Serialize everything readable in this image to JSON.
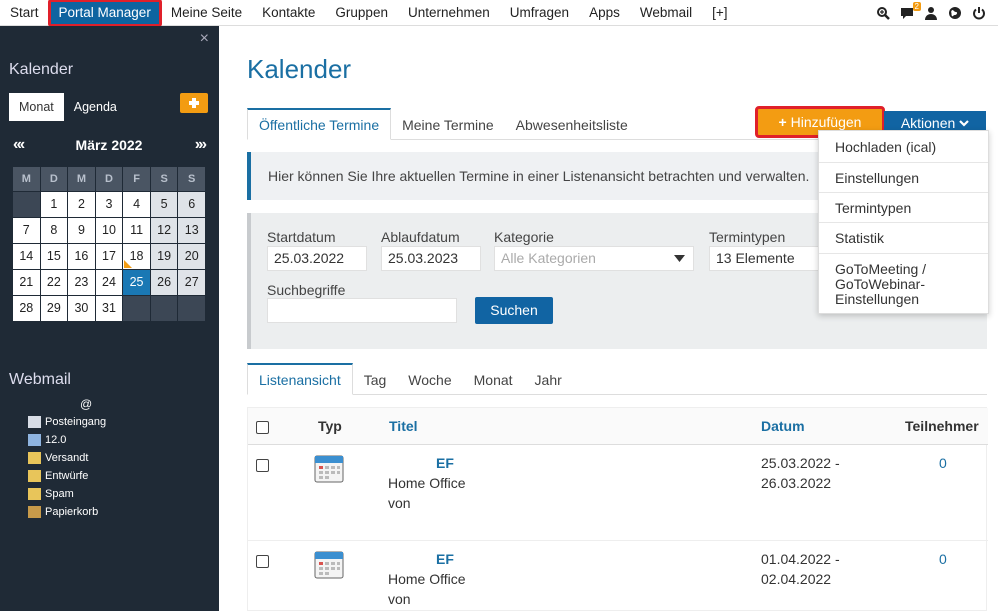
{
  "topnav": {
    "items": [
      "Start",
      "Portal Manager",
      "Meine Seite",
      "Kontakte",
      "Gruppen",
      "Unternehmen",
      "Umfragen",
      "Apps",
      "Webmail",
      "[+]"
    ],
    "active_index": 1,
    "notification_count": "2",
    "icons": [
      "search-icon",
      "chat-icon",
      "user-icon",
      "globe-icon",
      "power-icon"
    ]
  },
  "sidebar": {
    "close": "×",
    "calendar_title": "Kalender",
    "tabs": [
      "Monat",
      "Agenda"
    ],
    "add": "+",
    "month_label": "März 2022",
    "nav_prev": "«‹",
    "nav_next": "›»",
    "weekday_headers": [
      "M",
      "D",
      "M",
      "D",
      "F",
      "S",
      "S"
    ],
    "weeks": [
      [
        "",
        "1",
        "2",
        "3",
        "4",
        "5",
        "6"
      ],
      [
        "7",
        "8",
        "9",
        "10",
        "11",
        "12",
        "13"
      ],
      [
        "14",
        "15",
        "16",
        "17",
        "18",
        "19",
        "20"
      ],
      [
        "21",
        "22",
        "23",
        "24",
        "25",
        "26",
        "27"
      ],
      [
        "28",
        "29",
        "30",
        "31",
        "",
        "",
        ""
      ]
    ],
    "today": "25",
    "marked_day": "18",
    "webmail_title": "Webmail",
    "webmail_account": "@",
    "folders": [
      {
        "label": "Posteingang",
        "icon": "inbox-icon"
      },
      {
        "label": "12.0",
        "icon": "folder-icon"
      },
      {
        "label": "Versandt",
        "icon": "sent-icon"
      },
      {
        "label": "Entwürfe",
        "icon": "drafts-icon"
      },
      {
        "label": "Spam",
        "icon": "spam-icon"
      },
      {
        "label": "Papierkorb",
        "icon": "trash-icon"
      }
    ]
  },
  "main": {
    "title": "Kalender",
    "tabs": [
      "Öffentliche Termine",
      "Meine Termine",
      "Abwesenheitsliste"
    ],
    "add_button": "Hinzufügen",
    "actions_button": "Aktionen",
    "actions_menu": [
      "Hochladen (ical)",
      "Einstellungen",
      "Termintypen",
      "Statistik",
      "GoToMeeting / GoToWebinar-Einstellungen"
    ],
    "info_text": "Hier können Sie Ihre aktuellen Termine in einer Listenansicht betrachten und verwalten.",
    "filter": {
      "start_label": "Startdatum",
      "start_value": "25.03.2022",
      "end_label": "Ablaufdatum",
      "end_value": "25.03.2023",
      "category_label": "Kategorie",
      "category_placeholder": "Alle Kategorien",
      "types_label": "Termintypen",
      "types_value": "13 Elemente",
      "search_label": "Suchbegriffe",
      "search_value": "",
      "search_button": "Suchen"
    },
    "view_tabs": [
      "Listenansicht",
      "Tag",
      "Woche",
      "Monat",
      "Jahr"
    ],
    "table": {
      "headers": [
        "Typ",
        "Titel",
        "Datum",
        "Teilnehmer"
      ],
      "rows": [
        {
          "initials": "EF",
          "title_line1": "Home Office",
          "title_line2": "von",
          "date1": "25.03.2022 -",
          "date2": "26.03.2022",
          "participants": "0"
        },
        {
          "initials": "EF",
          "title_line1": "Home Office",
          "title_line2": "von",
          "date1": "01.04.2022 -",
          "date2": "02.04.2022",
          "participants": "0"
        }
      ]
    }
  },
  "colors": {
    "primary": "#1164a3",
    "accent": "#f39c12",
    "sidebar_bg": "#1f2a36",
    "highlight": "#e0202a"
  }
}
